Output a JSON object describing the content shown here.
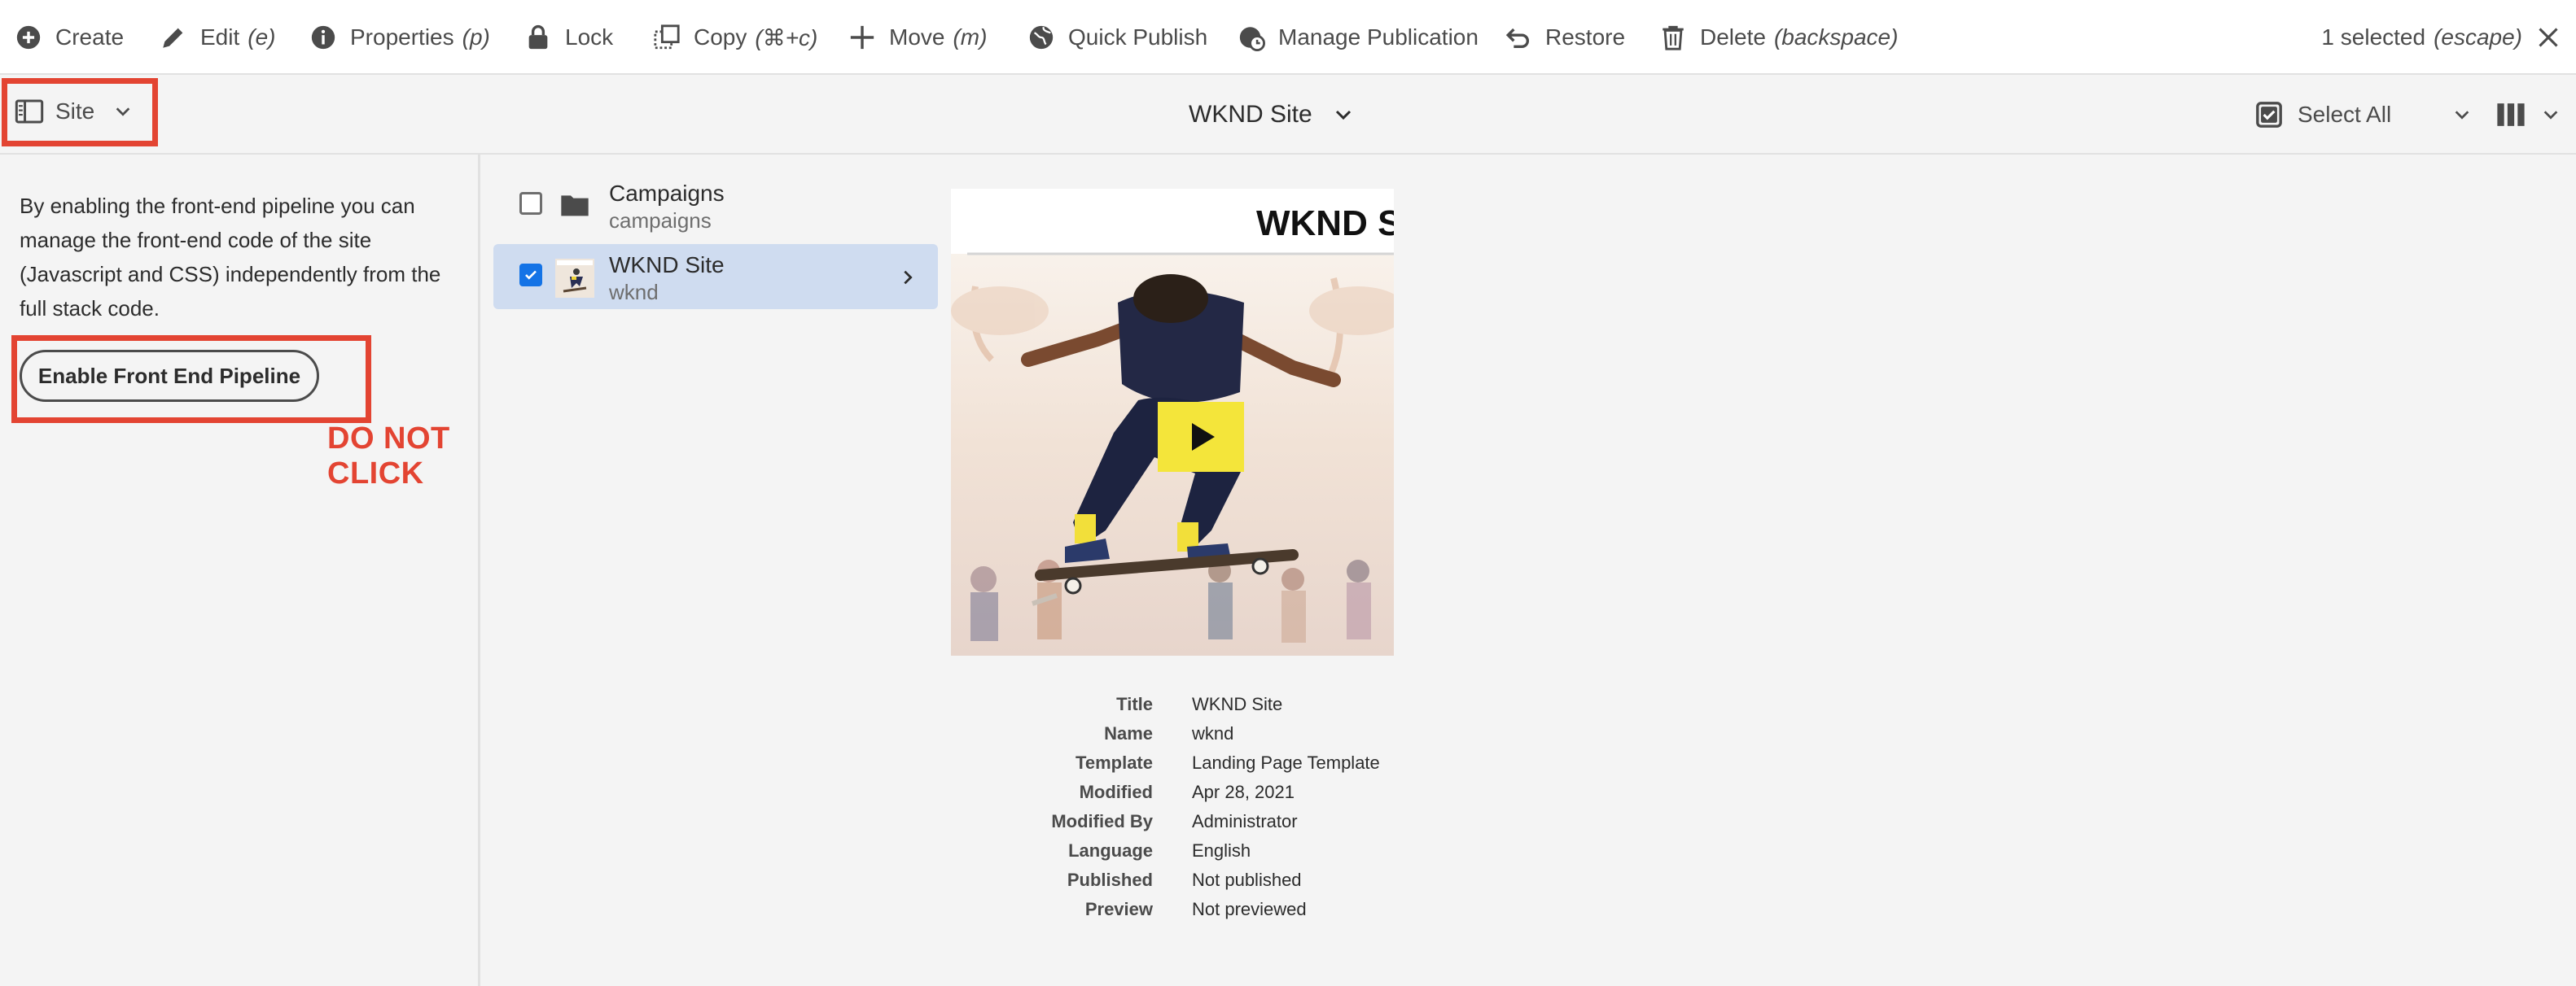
{
  "actionbar": {
    "create": "Create",
    "edit": "Edit",
    "edit_shortcut": "(e)",
    "properties": "Properties",
    "properties_shortcut": "(p)",
    "lock": "Lock",
    "copy": "Copy",
    "copy_shortcut": "(⌘+c)",
    "move": "Move",
    "move_shortcut": "(m)",
    "quick_publish": "Quick Publish",
    "manage_publication": "Manage Publication",
    "restore": "Restore",
    "delete": "Delete",
    "delete_shortcut": "(backspace)",
    "selected": "1 selected",
    "selected_shortcut": "(escape)"
  },
  "toolbar": {
    "rail_label": "Site",
    "breadcrumb": "WKND Site",
    "select_all": "Select All"
  },
  "rail": {
    "description": "By enabling the front-end pipeline you can manage the front-end code of the site (Javascript and CSS) independently from the full stack code.",
    "button": "Enable Front End Pipeline",
    "warning": "DO NOT CLICK"
  },
  "column": {
    "items": [
      {
        "title": "Campaigns",
        "name": "campaigns",
        "selected": false
      },
      {
        "title": "WKND Site",
        "name": "wknd",
        "selected": true
      }
    ]
  },
  "preview": {
    "image_heading": "WKND SIT",
    "metadata": [
      {
        "key": "Title",
        "value": "WKND Site"
      },
      {
        "key": "Name",
        "value": "wknd"
      },
      {
        "key": "Template",
        "value": "Landing Page Template"
      },
      {
        "key": "Modified",
        "value": "Apr 28, 2021"
      },
      {
        "key": "Modified By",
        "value": "Administrator"
      },
      {
        "key": "Language",
        "value": "English"
      },
      {
        "key": "Published",
        "value": "Not published"
      },
      {
        "key": "Preview",
        "value": "Not previewed"
      }
    ]
  },
  "colors": {
    "annotation": "#e34432",
    "accent": "#1473e6",
    "selected_row": "#cfdcf0"
  }
}
